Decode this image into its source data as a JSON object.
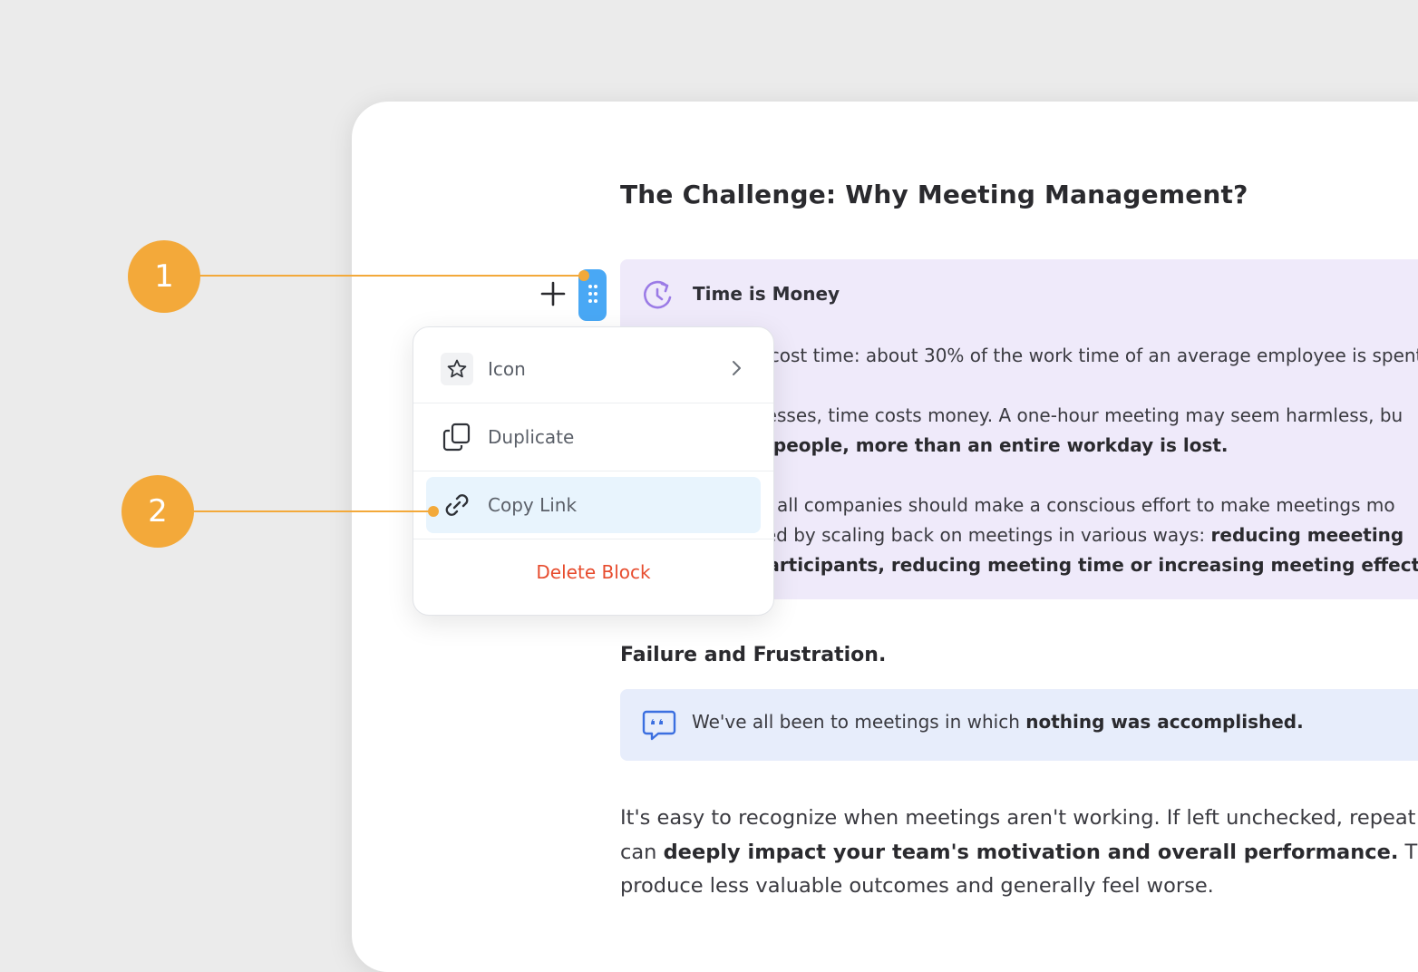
{
  "page": {
    "title": "The Challenge: Why Meeting Management?"
  },
  "callout_time": {
    "icon": "clock-refresh-icon",
    "title": "Time is Money",
    "p1": "s cost time: about 30% of the work time of an average employee is spent",
    "p2a": "nesses, time costs money. A one-hour meeting may seem harmless, bu",
    "p2b": "8 people, more than an entire workday is lost.",
    "p3a": "e, all companies should make a conscious effort to make meetings mo",
    "p3b_plain": "ved by scaling back on meetings in various ways: ",
    "p3b_bold": "reducing meeeting",
    "p3c": "participants, reducing meeting time or increasing meeting effectiv"
  },
  "section": {
    "heading": "Failure and Frustration."
  },
  "quote": {
    "icon": "quote-bubble-icon",
    "plain": "We've all been to meetings in which ",
    "bold": "nothing was accomplished."
  },
  "paragraph": {
    "line1": "It's easy to recognize when meetings aren't working. If left unchecked, repeat",
    "line2_plain_a": "can ",
    "line2_bold": "deeply impact your team's motivation and overall performance.",
    "line2_plain_b": " They",
    "line3": "produce less valuable outcomes and generally feel worse."
  },
  "block_controls": {
    "add_icon": "plus-icon",
    "handle_icon": "drag-handle-icon"
  },
  "context_menu": {
    "items": [
      {
        "label": "Icon",
        "icon": "star-icon",
        "has_submenu": true
      },
      {
        "label": "Duplicate",
        "icon": "duplicate-icon"
      },
      {
        "label": "Copy Link",
        "icon": "link-icon",
        "highlighted": true
      }
    ],
    "delete_label": "Delete Block"
  },
  "annotations": {
    "badge1": "1",
    "badge2": "2"
  },
  "colors": {
    "accent_blue": "#49a8f5",
    "annotation_orange": "#f3a93a",
    "delete_red": "#e74c2e",
    "callout_purple": "#efeafa",
    "callout_blue": "#e7edfb"
  }
}
